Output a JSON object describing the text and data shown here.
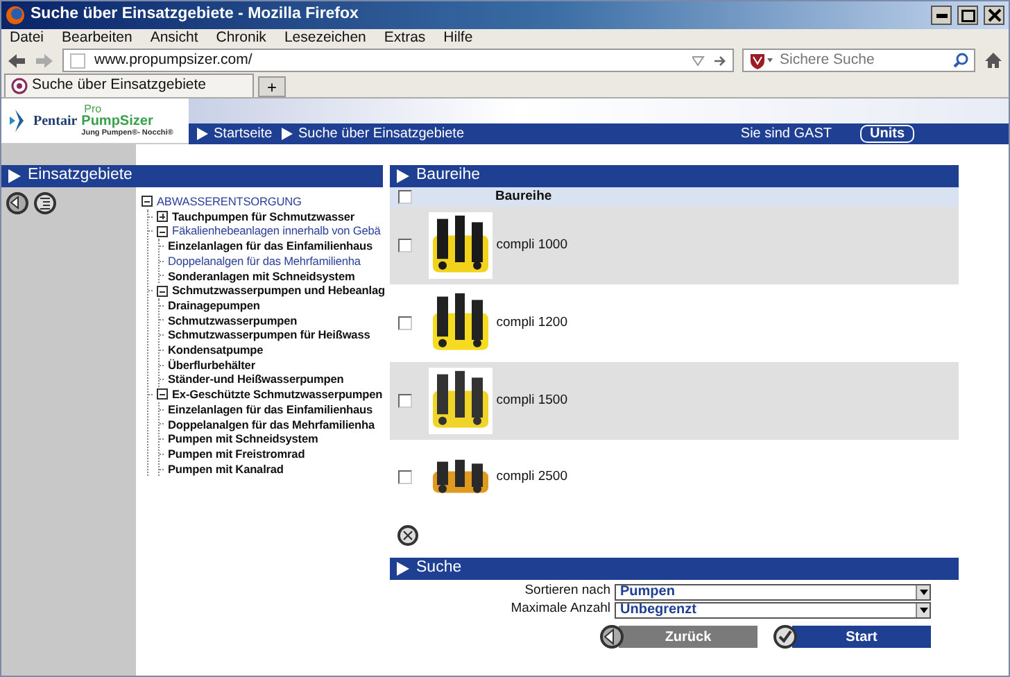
{
  "window": {
    "title": "Suche über Einsatzgebiete - Mozilla Firefox"
  },
  "menu": [
    "Datei",
    "Bearbeiten",
    "Ansicht",
    "Chronik",
    "Lesezeichen",
    "Extras",
    "Hilfe"
  ],
  "address_bar": {
    "value": "www.propumpsizer.com/"
  },
  "search": {
    "placeholder": "Sichere Suche"
  },
  "tabs": [
    {
      "label": "Suche über Einsatzgebiete",
      "selected": true
    }
  ],
  "new_tab": "+",
  "header": {
    "logo": {
      "brand": "Pentair",
      "pro": "Pro",
      "product": "PumpSizer",
      "tagline": "Jung Pumpen®- Nocchi®"
    },
    "breadcrumb": [
      "Startseite",
      "Suche über Einsatzgebiete"
    ],
    "user": "Sie sind GAST",
    "units_button": "Units"
  },
  "sidebar": {
    "title": "Einsatzgebiete",
    "tree": [
      {
        "label": "ABWASSERENTSORGUNG",
        "expanded": true,
        "selected": true,
        "children": [
          {
            "label": "Tauchpumpen für Schmutzwasser",
            "expanded": false,
            "selected": false
          },
          {
            "label": "Fäkalienhebeanlagen innerhalb von Gebä",
            "expanded": true,
            "selected": true,
            "children": [
              {
                "label": "Einzelanlagen für das Einfamilienhaus",
                "selected": false
              },
              {
                "label": "Doppelanalgen für das Mehrfamilienha",
                "selected": true
              },
              {
                "label": "Sonderanlagen mit Schneidsystem",
                "selected": false
              }
            ]
          },
          {
            "label": "Schmutzwasserpumpen und Hebeanlag",
            "expanded": true,
            "selected": false,
            "children": [
              {
                "label": "Drainagepumpen",
                "selected": false
              },
              {
                "label": "Schmutzwasserpumpen",
                "selected": false
              },
              {
                "label": "Schmutzwasserpumpen für Heißwass",
                "selected": false
              },
              {
                "label": "Kondensatpumpe",
                "selected": false
              },
              {
                "label": "Überflurbehälter",
                "selected": false
              },
              {
                "label": "Ständer-und Heißwasserpumpen",
                "selected": false
              }
            ]
          },
          {
            "label": "Ex-Geschützte Schmutzwasserpumpen",
            "expanded": true,
            "selected": false,
            "children": [
              {
                "label": "Einzelanlagen für das Einfamilienhaus",
                "selected": false
              },
              {
                "label": "Doppelanalgen für das Mehrfamilienha",
                "selected": false
              },
              {
                "label": "Pumpen mit Schneidsystem",
                "selected": false
              },
              {
                "label": "Pumpen mit Freistromrad",
                "selected": false
              },
              {
                "label": "Pumpen mit Kanalrad",
                "selected": false
              }
            ]
          }
        ]
      }
    ]
  },
  "series_panel": {
    "title": "Baureihe",
    "column": "Baureihe",
    "header_checked": false,
    "rows": [
      {
        "name": "compli 1000",
        "checked": false
      },
      {
        "name": "compli 1200",
        "checked": false
      },
      {
        "name": "compli 1500",
        "checked": false
      },
      {
        "name": "compli 2500",
        "checked": false
      }
    ]
  },
  "search_panel": {
    "title": "Suche",
    "fields": [
      {
        "label": "Sortieren nach",
        "value": "Pumpen"
      },
      {
        "label": "Maximale Anzahl",
        "value": "Unbegrenzt"
      }
    ],
    "buttons": [
      {
        "label": "Zurück",
        "kind": "back"
      },
      {
        "label": "Start",
        "kind": "start"
      }
    ]
  }
}
